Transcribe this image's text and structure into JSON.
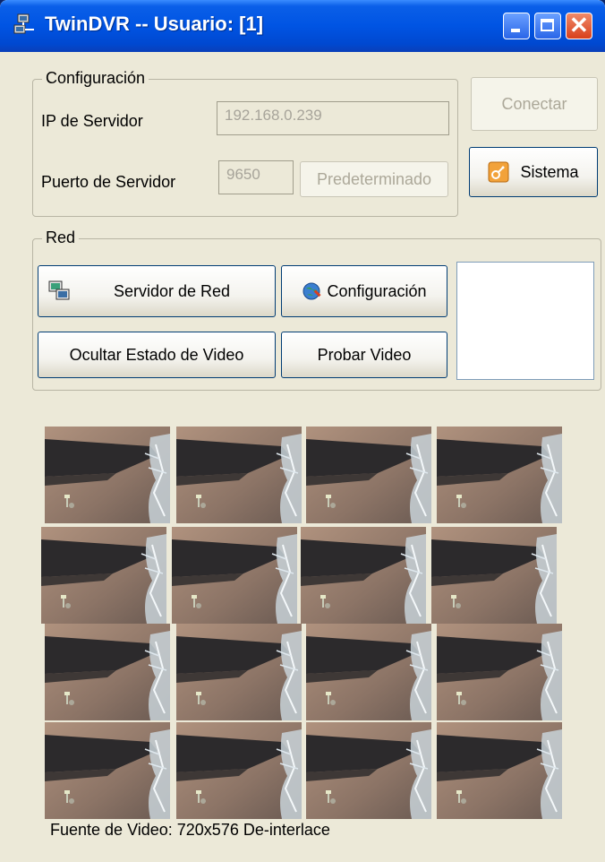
{
  "window": {
    "title": "TwinDVR -- Usuario: [1]"
  },
  "config": {
    "legend": "Configuración",
    "ip_label": "IP de Servidor",
    "ip_value": "192.168.0.239",
    "port_label": "Puerto de Servidor",
    "port_value": "9650",
    "default_button": "Predeterminado"
  },
  "actions": {
    "connect_button": "Conectar",
    "system_button": "Sistema"
  },
  "network": {
    "legend": "Red",
    "server_button": "Servidor de Red",
    "config_button": "Configuración",
    "hide_status_button": "Ocultar Estado de Video",
    "test_video_button": "Probar Video"
  },
  "video_grid": {
    "rows": 4,
    "columns": 4
  },
  "status": {
    "text": "Fuente de Video: 720x576 De-interlace"
  },
  "colors": {
    "titlebar": "#0054e3",
    "window_bg": "#ece9d8",
    "close_button": "#d8401c"
  }
}
